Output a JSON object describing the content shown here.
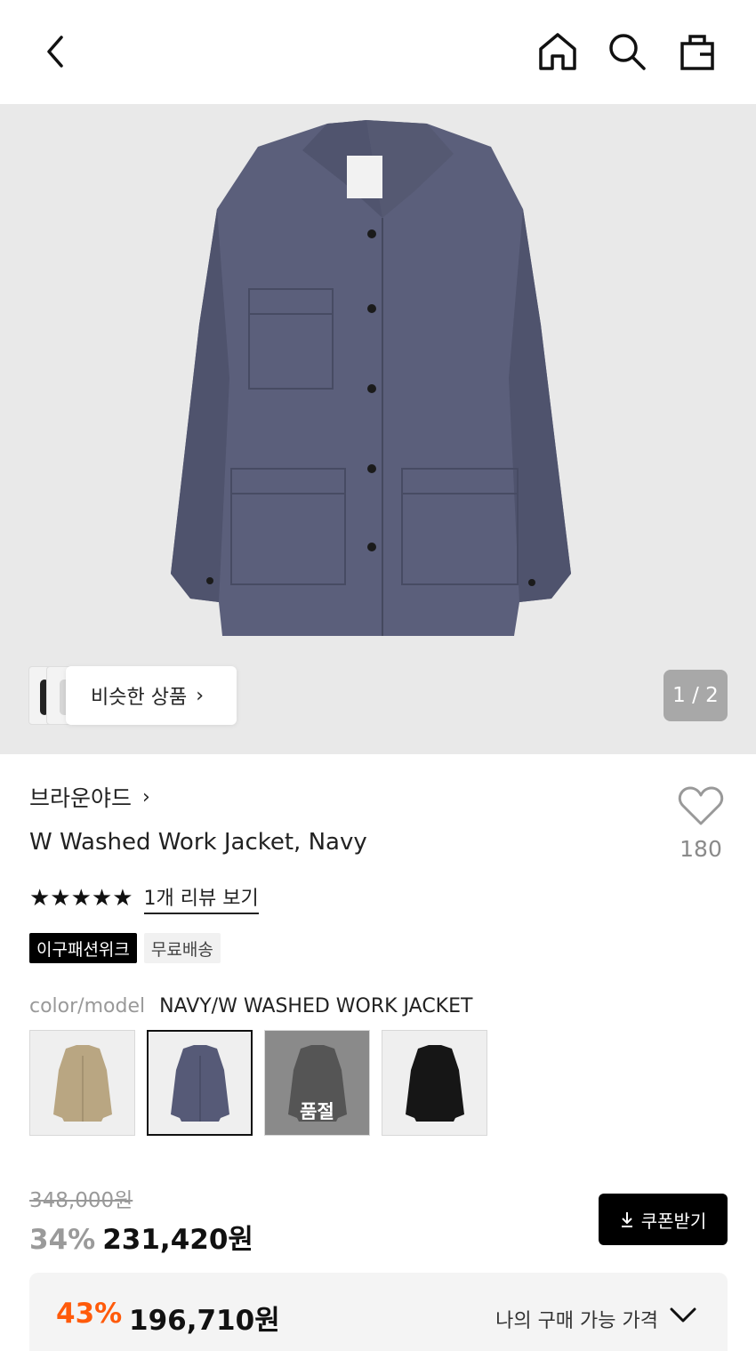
{
  "header": {
    "back_icon": "chevron-left-icon",
    "home_icon": "home-icon",
    "search_icon": "search-icon",
    "bag_icon": "shopping-bag-icon"
  },
  "gallery": {
    "similar_label": "비슷한 상품",
    "similar_chevron": "›",
    "page_counter": "1 / 2",
    "background": "#e9e9e9",
    "jacket_color": "#5b5f7b"
  },
  "product": {
    "brand": "브라운야드",
    "brand_chevron": "›",
    "title": "W Washed Work Jacket, Navy",
    "like_count": "180",
    "stars": "★★★★★",
    "review_link": "1개 리뷰 보기",
    "badges": [
      "이구패션위크",
      "무료배송"
    ],
    "color_key": "color/model",
    "color_value": "NAVY/W WASHED WORK JACKET",
    "swatches": [
      {
        "name": "beige",
        "color": "#b9a682",
        "selected": false,
        "soldout": false
      },
      {
        "name": "navy",
        "color": "#565a77",
        "selected": true,
        "soldout": false
      },
      {
        "name": "charcoal",
        "color": "#555555",
        "selected": false,
        "soldout": true,
        "label": "품절"
      },
      {
        "name": "black",
        "color": "#161616",
        "selected": false,
        "soldout": false
      }
    ]
  },
  "price": {
    "original": "348,000원",
    "discount_pct": "34%",
    "sale": "231,420원",
    "coupon_label": "쿠폰받기",
    "best_pct": "43%",
    "best_price": "196,710원",
    "best_label": "나의 구매 가능 가격",
    "accent_color": "#ff5a0a"
  }
}
